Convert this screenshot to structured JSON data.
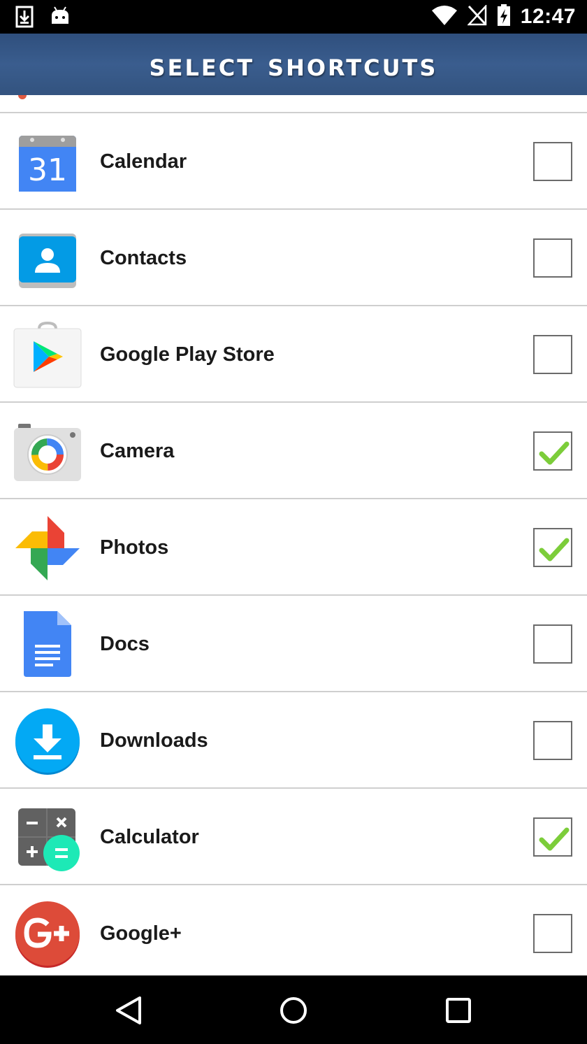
{
  "status_bar": {
    "time": "12:47",
    "icons_left": [
      "download-notification-icon",
      "android-icon"
    ],
    "icons_right": [
      "wifi-icon",
      "no-signal-icon",
      "battery-charging-icon"
    ]
  },
  "app_bar": {
    "title": "Select Shortcuts"
  },
  "items": [
    {
      "label": "Calendar",
      "icon": "calendar-icon",
      "checked": false
    },
    {
      "label": "Contacts",
      "icon": "contacts-icon",
      "checked": false
    },
    {
      "label": "Google Play Store",
      "icon": "play-store-icon",
      "checked": false
    },
    {
      "label": "Camera",
      "icon": "camera-icon",
      "checked": true
    },
    {
      "label": "Photos",
      "icon": "photos-icon",
      "checked": true
    },
    {
      "label": "Docs",
      "icon": "docs-icon",
      "checked": false
    },
    {
      "label": "Downloads",
      "icon": "downloads-icon",
      "checked": false
    },
    {
      "label": "Calculator",
      "icon": "calculator-icon",
      "checked": true
    },
    {
      "label": "Google+",
      "icon": "google-plus-icon",
      "checked": false
    }
  ],
  "calendar_day": "31",
  "nav_bar": {
    "buttons": [
      "back-icon",
      "home-icon",
      "recents-icon"
    ]
  },
  "colors": {
    "app_bar": "#33537f",
    "check_green": "#7ccd3a",
    "divider": "#cfcfcf"
  }
}
